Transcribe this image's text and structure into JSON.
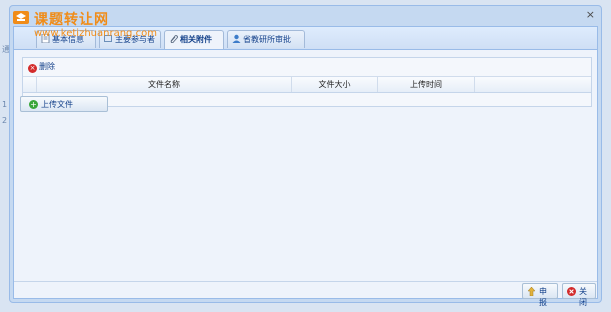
{
  "background": {
    "ghost_items": [
      "通",
      "1",
      "2"
    ]
  },
  "window": {
    "title": "课题转让网",
    "watermark_url": "www.ketizhuanrang.com",
    "close_symbol": "×",
    "logo_icon": "watermark-logo-icon"
  },
  "tabs": [
    {
      "label": "基本信息",
      "icon": "doc-icon",
      "active": false
    },
    {
      "label": "主要参与者",
      "icon": "people-icon",
      "active": false
    },
    {
      "label": "相关附件",
      "icon": "paperclip-icon",
      "active": true
    },
    {
      "label": "省教研所审批",
      "icon": "user-approve-icon",
      "active": false
    }
  ],
  "attachments": {
    "delete_label": "删除",
    "columns": [
      "文件名称",
      "文件大小",
      "上传时间"
    ],
    "rows": []
  },
  "upload": {
    "label": "上传文件"
  },
  "footer": {
    "submit_label": "申报",
    "close_label": "关闭"
  },
  "colors": {
    "accent": "#15428b",
    "border": "#99bbe8",
    "watermark": "#f08c18",
    "delete_red": "#d32b2b",
    "add_green": "#3aa63a"
  }
}
